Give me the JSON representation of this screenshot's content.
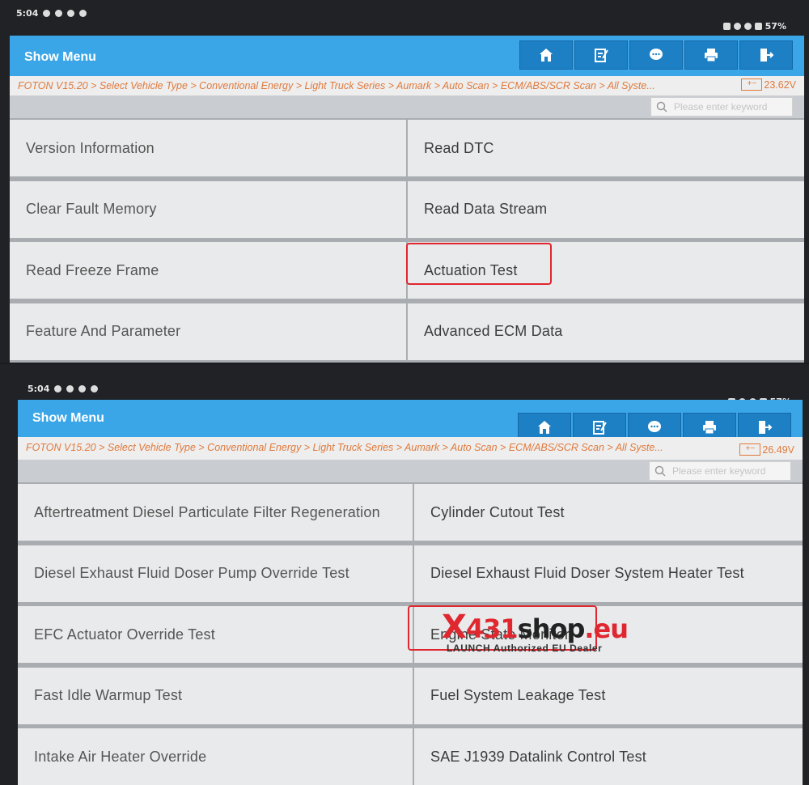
{
  "status": {
    "time": "5:04",
    "battery": "57%"
  },
  "header": {
    "title": "Show Menu"
  },
  "toolbar": {
    "icons": [
      "home-icon",
      "report-icon",
      "feedback-icon",
      "print-icon",
      "exit-icon"
    ]
  },
  "breadcrumb": "FOTON V15.20 > Select Vehicle Type > Conventional Energy > Light Truck Series > Aumark > Auto Scan > ECM/ABS/SCR Scan > All Syste...",
  "search": {
    "placeholder": "Please enter keyword"
  },
  "screenshot1": {
    "voltage": "23.62V",
    "menu_items": [
      "Version Information",
      "Read DTC",
      "Clear Fault Memory",
      "Read Data Stream",
      "Read Freeze Frame",
      "Actuation Test",
      "Feature And Parameter",
      "Advanced ECM Data"
    ],
    "highlighted_item": "Actuation Test"
  },
  "screenshot2": {
    "voltage": "26.49V",
    "menu_items": [
      "Aftertreatment Diesel Particulate Filter Regeneration",
      "Cylinder Cutout Test",
      "Diesel Exhaust Fluid Doser Pump Override Test",
      "Diesel Exhaust Fluid Doser System Heater Test",
      "EFC Actuator Override Test",
      "Engine State Monitor",
      "Fast Idle Warmup Test",
      "Fuel System Leakage Test",
      "Intake Air Heater Override",
      "SAE J1939 Datalink Control Test"
    ],
    "highlighted_item": "Engine State Monitor"
  },
  "watermark": {
    "logo_x": "X",
    "logo_num": "431",
    "logo_shop": "shop",
    "logo_eu": ".eu",
    "tagline": "LAUNCH Authorized EU Dealer"
  },
  "colors": {
    "header": "#3aa6e8",
    "toolbar_button": "#1d7fc4",
    "breadcrumb": "#e07a3c",
    "highlight_box": "#e0262f"
  }
}
